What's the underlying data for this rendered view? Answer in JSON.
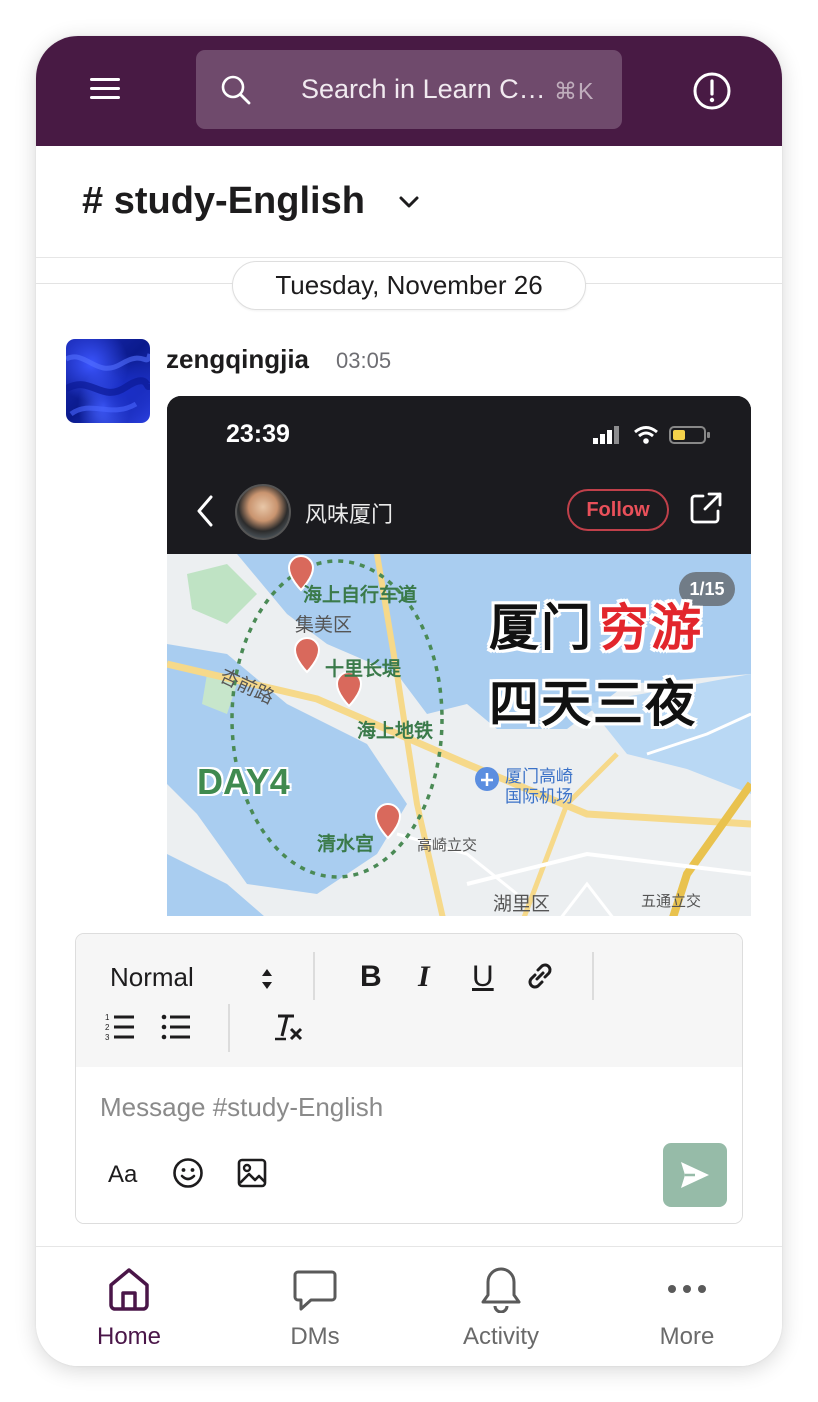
{
  "topbar": {
    "search_placeholder": "Search in Learn C…",
    "search_shortcut": "⌘K"
  },
  "channel": {
    "name": "# study-English"
  },
  "messages": {
    "date_divider": "Tuesday, November 26",
    "items": [
      {
        "author": "zengqingjia",
        "time": "03:05",
        "attachment": {
          "status_time": "23:39",
          "post_author": "风味厦门",
          "follow_label": "Follow",
          "page_indicator": "1/15",
          "title_line1_a": "厦门",
          "title_line1_b": "穷游",
          "title_line2": "四天三夜",
          "day_label": "DAY4",
          "map_places": {
            "p1": "海上自行车道",
            "p2": "集美区",
            "p3": "十里长堤",
            "p4": "杏前路",
            "p5": "海上地铁",
            "p6": "厦门高崎",
            "p7": "国际机场",
            "p8": "清水宫",
            "p9": "高崎立交",
            "p10": "湖里区",
            "p11": "五通立交"
          }
        }
      }
    ]
  },
  "composer": {
    "text_style": "Normal",
    "placeholder": "Message #study-English",
    "format_label": "Aa",
    "bold": "B",
    "italic": "I",
    "underline": "U"
  },
  "nav": {
    "items": [
      {
        "label": "Home",
        "icon": "home-icon",
        "active": true
      },
      {
        "label": "DMs",
        "icon": "chat-bubble-icon"
      },
      {
        "label": "Activity",
        "icon": "bell-icon"
      },
      {
        "label": "More",
        "icon": "more-dots-icon"
      }
    ]
  },
  "colors": {
    "topbar": "#481a44",
    "accent": "#4a1648",
    "send_button": "#96bba8",
    "follow": "#e9505a"
  }
}
